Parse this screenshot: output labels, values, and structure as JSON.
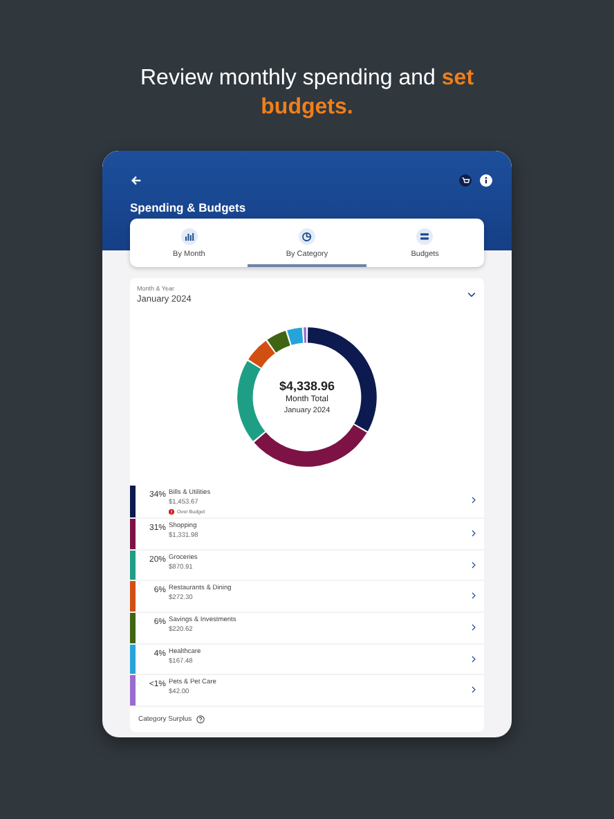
{
  "headline": {
    "text": "Review monthly spending and ",
    "highlight": "set budgets."
  },
  "app_bar": {
    "title": "Spending & Budgets"
  },
  "tabs": [
    {
      "label": "By Month",
      "kind": "bars",
      "selected": false
    },
    {
      "label": "By Category",
      "kind": "pie",
      "selected": true
    },
    {
      "label": "Budgets",
      "kind": "list",
      "selected": false
    }
  ],
  "month_select": {
    "label": "Month & Year",
    "value": "January 2024"
  },
  "donut": {
    "amount": "$4,338.96",
    "caption": "Month Total",
    "period": "January 2024"
  },
  "categories": [
    {
      "percent": "34%",
      "name": "Bills & Utilities",
      "amount": "$1,453.67",
      "color": "#0d1a4f",
      "warning": "Over Budget"
    },
    {
      "percent": "31%",
      "name": "Shopping",
      "amount": "$1,331.98",
      "color": "#7d1245"
    },
    {
      "percent": "20%",
      "name": "Groceries",
      "amount": "$870.91",
      "color": "#1f9e86"
    },
    {
      "percent": "6%",
      "name": "Restaurants & Dining",
      "amount": "$272.30",
      "color": "#d24f12"
    },
    {
      "percent": "6%",
      "name": "Savings & Investments",
      "amount": "$220.62",
      "color": "#3f6512"
    },
    {
      "percent": "4%",
      "name": "Healthcare",
      "amount": "$167.48",
      "color": "#26a3d8"
    },
    {
      "percent": "<1%",
      "name": "Pets & Pet Care",
      "amount": "$42.00",
      "color": "#9a6ad0"
    }
  ],
  "surplus": {
    "label": "Category Surplus"
  }
}
